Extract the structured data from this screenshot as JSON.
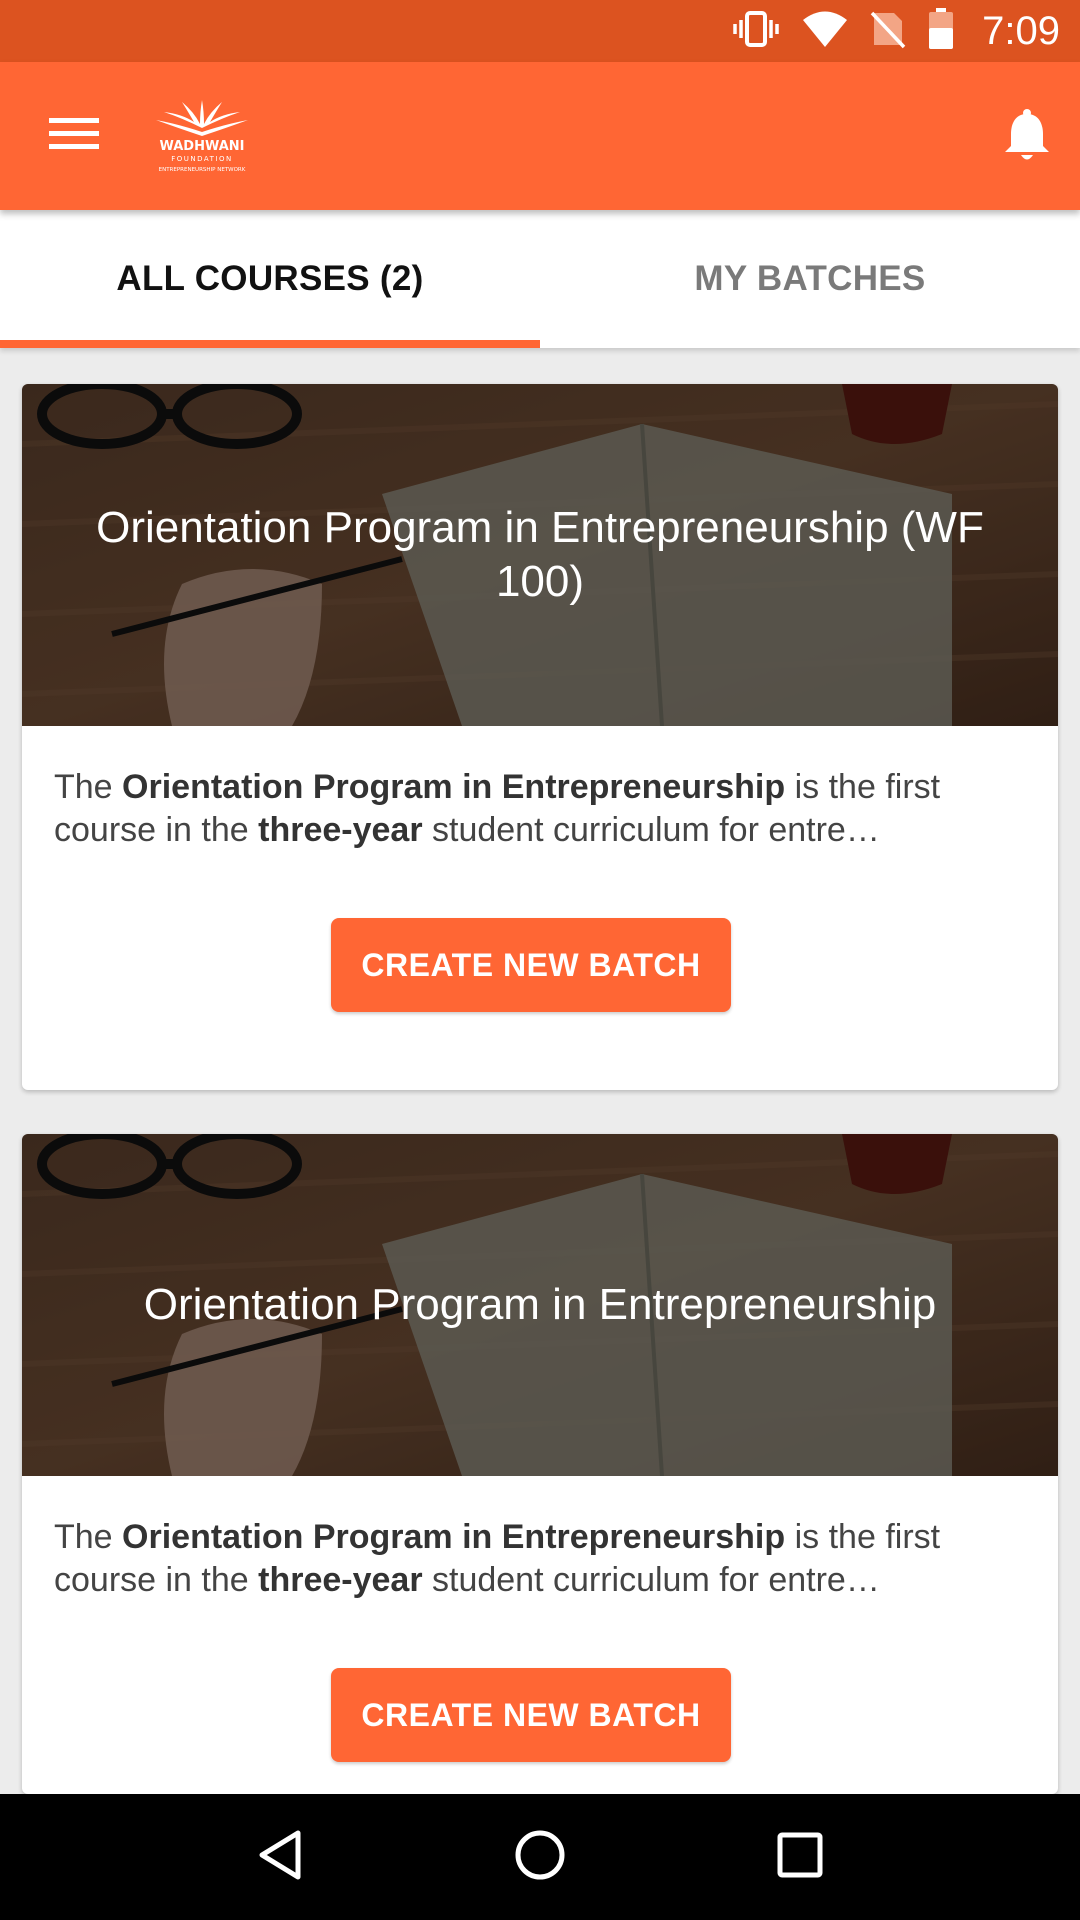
{
  "status_bar": {
    "time": "7:09",
    "icons": [
      "vibrate-icon",
      "wifi-icon",
      "no-sim-icon",
      "battery-icon"
    ]
  },
  "app_bar": {
    "menu_icon": "hamburger-menu-icon",
    "logo": {
      "name": "WADHWANI",
      "sub1": "FOUNDATION",
      "sub2": "ENTREPRENEURSHIP NETWORK"
    },
    "notification_icon": "bell-icon",
    "color": "#ff6634"
  },
  "tabs": [
    {
      "label": "ALL COURSES (2)",
      "active": true
    },
    {
      "label": "MY BATCHES",
      "active": false
    }
  ],
  "courses": [
    {
      "title": "Orientation Program in Entrepreneurship (WF 100)",
      "desc_pre": "The ",
      "desc_b1": "Orientation Program in Entrepreneurship",
      "desc_mid": " is the first course in the ",
      "desc_b2": "three-year",
      "desc_post": " student curriculum for entre…",
      "button": "CREATE NEW BATCH"
    },
    {
      "title": "Orientation Program in Entrepreneurship",
      "desc_pre": "The ",
      "desc_b1": "Orientation Program in Entrepreneurship",
      "desc_mid": " is the first course in the ",
      "desc_b2": "three-year",
      "desc_post": " student curriculum for entre…",
      "button": "CREATE NEW BATCH"
    }
  ],
  "nav_bar": {
    "icons": [
      "back-icon",
      "home-icon",
      "recents-icon"
    ]
  },
  "colors": {
    "accent": "#ff6634",
    "status_bar": "#dc5320"
  }
}
